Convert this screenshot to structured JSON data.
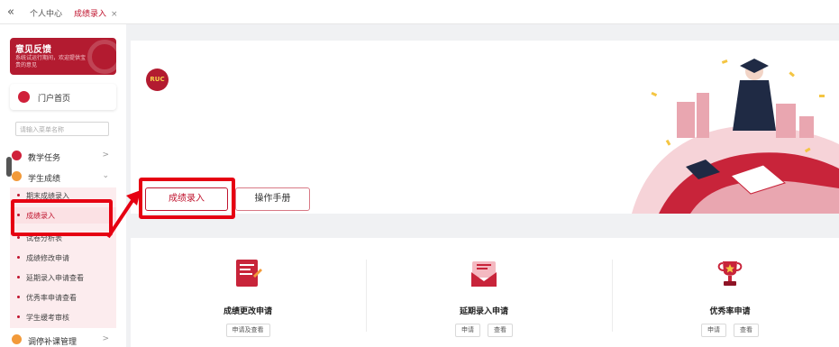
{
  "tabs": {
    "collapse_glyph": "«",
    "items": [
      {
        "label": "个人中心"
      },
      {
        "label": "成绩录入",
        "close": "×"
      }
    ]
  },
  "sidebar": {
    "feedback": {
      "title": "意见反馈",
      "subtitle": "系统试运行期间，欢迎提供宝贵的意见"
    },
    "portal": {
      "label": "门户首页"
    },
    "search": {
      "placeholder": "请输入菜单名称"
    },
    "menu": [
      {
        "label": "教学任务",
        "chevron": ">"
      },
      {
        "label": "学生成绩",
        "chevron": "⌄"
      },
      {
        "label": "调停补课管理",
        "chevron": ">"
      }
    ],
    "submenu": [
      {
        "label": "期末成绩录入"
      },
      {
        "label": "成绩录入",
        "active": true
      },
      {
        "label": "试卷分析表"
      },
      {
        "label": "成绩修改申请"
      },
      {
        "label": "延期录入申请查看"
      },
      {
        "label": "优秀率申请查看"
      },
      {
        "label": "学生缓考审核"
      }
    ]
  },
  "banner": {
    "logo_text": "RUC",
    "entry_button": "成绩录入",
    "manual_button": "操作手册"
  },
  "cards": [
    {
      "title": "成绩更改申请",
      "icon": "notebook-icon",
      "buttons": [
        "申请及查看"
      ]
    },
    {
      "title": "延期录入申请",
      "icon": "envelope-icon",
      "buttons": [
        "申请",
        "查看"
      ]
    },
    {
      "title": "优秀率申请",
      "icon": "trophy-icon",
      "buttons": [
        "申请",
        "查看"
      ]
    }
  ],
  "colors": {
    "brand": "#b31b30",
    "highlight": "#e60012",
    "accent_orange": "#f29a3a"
  }
}
